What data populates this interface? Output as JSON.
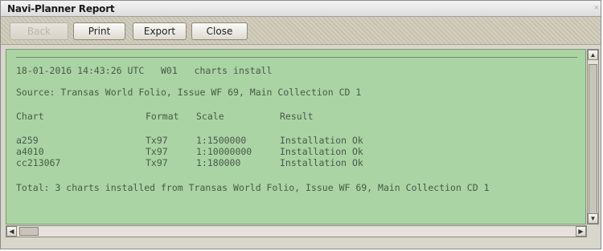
{
  "window": {
    "title": "Navi-Planner Report",
    "close_glyph": "×"
  },
  "toolbar": {
    "back_label": "Back",
    "print_label": "Print",
    "export_label": "Export",
    "close_label": "Close"
  },
  "report": {
    "header_line": "18-01-2016 14:43:26 UTC   W01   charts install",
    "source_line": "Source: Transas World Folio, Issue WF 69, Main Collection CD 1",
    "columns": [
      "Chart",
      "Format",
      "Scale",
      "Result"
    ],
    "rows": [
      [
        "a259",
        "Tx97",
        "1:1500000",
        "Installation Ok"
      ],
      [
        "a4010",
        "Tx97",
        "1:10000000",
        "Installation Ok"
      ],
      [
        "cc213067",
        "Tx97",
        "1:180000",
        "Installation Ok"
      ]
    ],
    "total_line": "Total: 3 charts installed from Transas World Folio, Issue WF 69, Main Collection CD 1"
  },
  "scrollbars": {
    "up_glyph": "▲",
    "down_glyph": "▼",
    "left_glyph": "◀",
    "right_glyph": "▶"
  },
  "colors": {
    "report_background": "#aad4a4",
    "report_text": "#4a5a4a"
  }
}
